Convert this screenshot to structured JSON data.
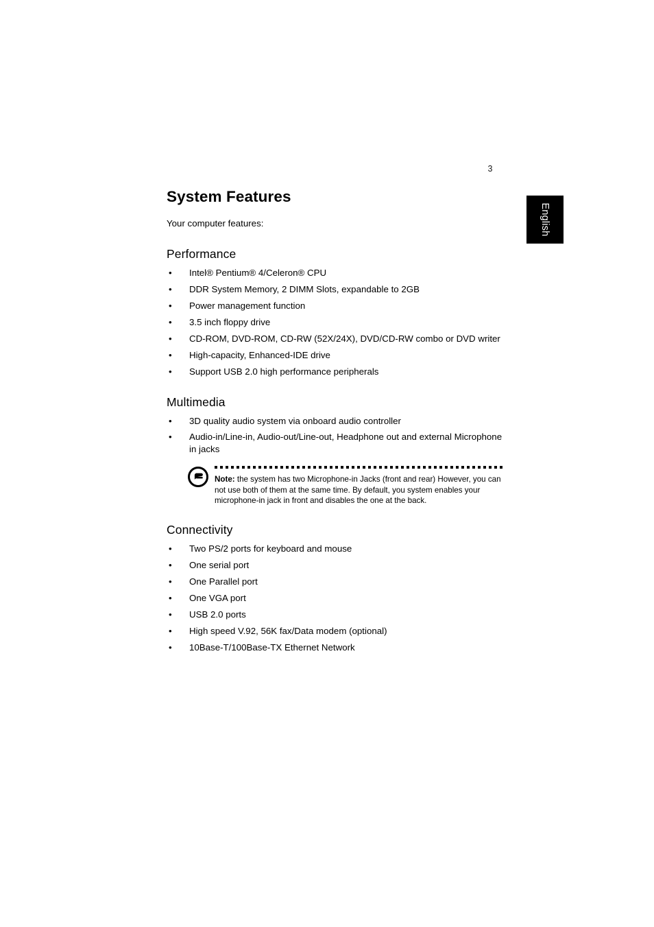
{
  "page": {
    "number": "3",
    "language_tab": "English"
  },
  "document": {
    "title": "System Features",
    "intro": "Your computer features:"
  },
  "sections": [
    {
      "heading": "Performance",
      "bullets": [
        "Intel® Pentium® 4/Celeron® CPU",
        "DDR  System Memory, 2 DIMM Slots, expandable to 2GB",
        "Power management function",
        "3.5 inch floppy drive",
        "CD-ROM, DVD-ROM, CD-RW (52X/24X), DVD/CD-RW combo  or DVD writer",
        "High-capacity, Enhanced-IDE drive",
        "Support USB 2.0 high performance peripherals"
      ]
    },
    {
      "heading": "Multimedia",
      "bullets": [
        "3D quality audio system via onboard audio controller",
        "Audio-in/Line-in, Audio-out/Line-out, Headphone out and external Microphone in jacks"
      ]
    },
    {
      "heading": "Connectivity",
      "bullets": [
        "Two PS/2 ports for keyboard and mouse",
        "One serial port",
        "One Parallel port",
        "One VGA port",
        "USB 2.0 ports",
        "High speed V.92, 56K fax/Data modem (optional)",
        "10Base-T/100Base-TX Ethernet Network"
      ]
    }
  ],
  "note": {
    "icon": "acer-logo-icon",
    "label": "Note:",
    "body": " the system has two Microphone-in Jacks (front and rear) However, you can not use both of them at the same time. By default, you system enables your microphone-in jack in front and disables the one at the back."
  },
  "bullet_glyph": "•",
  "colors": {
    "text": "#000000",
    "tab_background": "#000000",
    "tab_text": "#ffffff",
    "page_background": "#ffffff"
  }
}
